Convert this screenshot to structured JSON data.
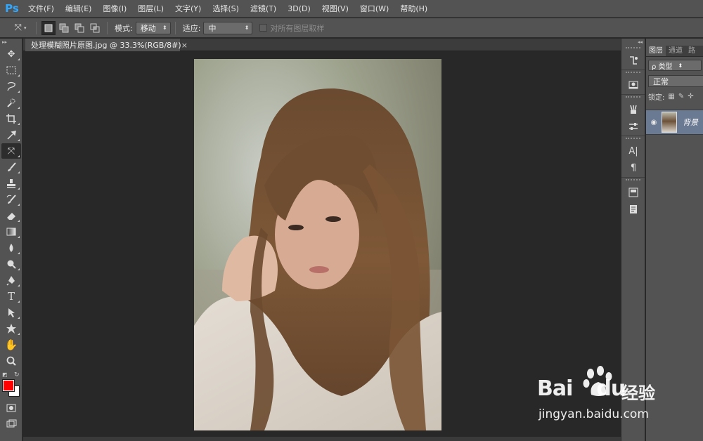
{
  "app": {
    "logo": "Ps"
  },
  "menu": [
    "文件(F)",
    "编辑(E)",
    "图像(I)",
    "图层(L)",
    "文字(Y)",
    "选择(S)",
    "滤镜(T)",
    "3D(D)",
    "视图(V)",
    "窗口(W)",
    "帮助(H)"
  ],
  "options": {
    "mode_label": "模式:",
    "mode_value": "移动",
    "adapt_label": "适应:",
    "adapt_value": "中",
    "sample_all_label": "对所有图层取样"
  },
  "document": {
    "tab_title": "处理模糊照片原图.jpg @ 33.3%(RGB/8#)",
    "close_glyph": "×"
  },
  "tools": [
    {
      "name": "move-tool",
      "icon": "move-icon"
    },
    {
      "name": "marquee-tool",
      "icon": "rect-marquee-icon"
    },
    {
      "name": "lasso-tool",
      "icon": "lasso-icon"
    },
    {
      "name": "quick-select-tool",
      "icon": "quick-select-icon"
    },
    {
      "name": "crop-tool",
      "icon": "crop-icon"
    },
    {
      "name": "eyedropper-tool",
      "icon": "eyedropper-icon"
    },
    {
      "name": "content-aware-move-tool",
      "icon": "content-aware-move-icon",
      "active": true
    },
    {
      "name": "brush-tool",
      "icon": "brush-icon"
    },
    {
      "name": "stamp-tool",
      "icon": "stamp-icon"
    },
    {
      "name": "history-brush-tool",
      "icon": "history-brush-icon"
    },
    {
      "name": "eraser-tool",
      "icon": "eraser-icon"
    },
    {
      "name": "gradient-tool",
      "icon": "gradient-icon"
    },
    {
      "name": "blur-tool",
      "icon": "blur-icon"
    },
    {
      "name": "dodge-tool",
      "icon": "dodge-icon"
    },
    {
      "name": "pen-tool",
      "icon": "pen-icon"
    },
    {
      "name": "type-tool",
      "icon": "type-icon"
    },
    {
      "name": "path-select-tool",
      "icon": "path-select-icon"
    },
    {
      "name": "shape-tool",
      "icon": "shape-icon"
    },
    {
      "name": "hand-tool",
      "icon": "hand-icon"
    },
    {
      "name": "zoom-tool",
      "icon": "zoom-icon"
    }
  ],
  "colors": {
    "foreground": "#ff0000",
    "background": "#ffffff"
  },
  "layers_panel": {
    "tabs": [
      "图层",
      "通道",
      "路"
    ],
    "filter_label": "ρ 类型",
    "blend_mode": "正常",
    "lock_label": "锁定:",
    "layer_name": "背景"
  },
  "watermark": {
    "logo": "Bai",
    "logo_suffix": "du",
    "cn": "经验",
    "url": "jingyan.baidu.com"
  }
}
